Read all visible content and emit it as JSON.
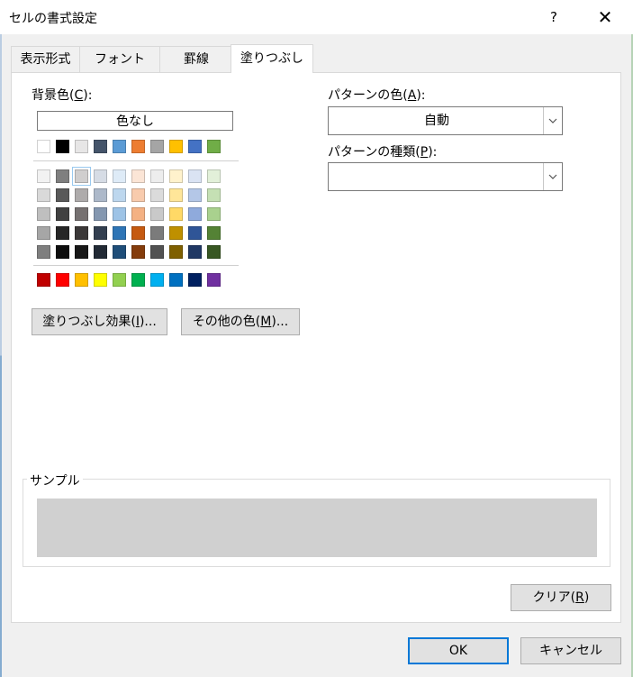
{
  "window": {
    "title": "セルの書式設定",
    "help_label": "?",
    "close_label": "✕",
    "accent_color": "#0078d7"
  },
  "tabs": [
    {
      "label": "表示形式",
      "active": false
    },
    {
      "label": "フォント",
      "active": false
    },
    {
      "label": "罫線",
      "active": false
    },
    {
      "label": "塗りつぶし",
      "active": true
    }
  ],
  "fill": {
    "background_label_prefix": "背景色(",
    "background_label_key": "C",
    "background_label_suffix": "):",
    "no_color_label": "色なし",
    "theme_row": [
      "#ffffff",
      "#000000",
      "#e7e6e6",
      "#44546a",
      "#5b9bd5",
      "#ed7d31",
      "#a5a5a5",
      "#ffc000",
      "#4472c4",
      "#70ad47"
    ],
    "tint_rows": [
      [
        "#f2f2f2",
        "#7f7f7f",
        "#d0cece",
        "#d6dce5",
        "#deebf7",
        "#fbe5d6",
        "#ededed",
        "#fff2cc",
        "#dae3f3",
        "#e2f0d9"
      ],
      [
        "#d9d9d9",
        "#595959",
        "#aeabab",
        "#adb9ca",
        "#bdd7ee",
        "#f8cbad",
        "#dbdbdb",
        "#ffe699",
        "#b4c7e7",
        "#c5e0b4"
      ],
      [
        "#bfbfbf",
        "#404040",
        "#767171",
        "#8497b0",
        "#9dc3e6",
        "#f4b183",
        "#c9c9c9",
        "#ffd966",
        "#8faadc",
        "#a9d18e"
      ],
      [
        "#a6a6a6",
        "#262626",
        "#3b3838",
        "#333f50",
        "#2e75b6",
        "#c55a11",
        "#7b7b7b",
        "#bf9000",
        "#2f5597",
        "#548235"
      ],
      [
        "#7f7f7f",
        "#0d0d0d",
        "#171717",
        "#222a35",
        "#1f4e79",
        "#843c0c",
        "#525252",
        "#7f6000",
        "#203864",
        "#385723"
      ]
    ],
    "selected_swatch": {
      "row": 0,
      "col": 2
    },
    "standard_row": [
      "#c00000",
      "#ff0000",
      "#ffc000",
      "#ffff00",
      "#92d050",
      "#00b050",
      "#00b0f0",
      "#0070c0",
      "#002060",
      "#7030a0"
    ],
    "fill_effects_button": {
      "prefix": "塗りつぶし効果(",
      "key": "I",
      "suffix": ")..."
    },
    "more_colors_button": {
      "prefix": "その他の色(",
      "key": "M",
      "suffix": ")..."
    }
  },
  "pattern": {
    "color_label": {
      "prefix": "パターンの色(",
      "key": "A",
      "suffix": "):"
    },
    "color_value": "自動",
    "style_label": {
      "prefix": "パターンの種類(",
      "key": "P",
      "suffix": "):"
    },
    "style_value": ""
  },
  "sample": {
    "label": "サンプル",
    "preview_color": "#d0d0d0"
  },
  "clear_button": {
    "prefix": "クリア(",
    "key": "R",
    "suffix": ")"
  },
  "ok_button": "OK",
  "cancel_button": "キャンセル"
}
